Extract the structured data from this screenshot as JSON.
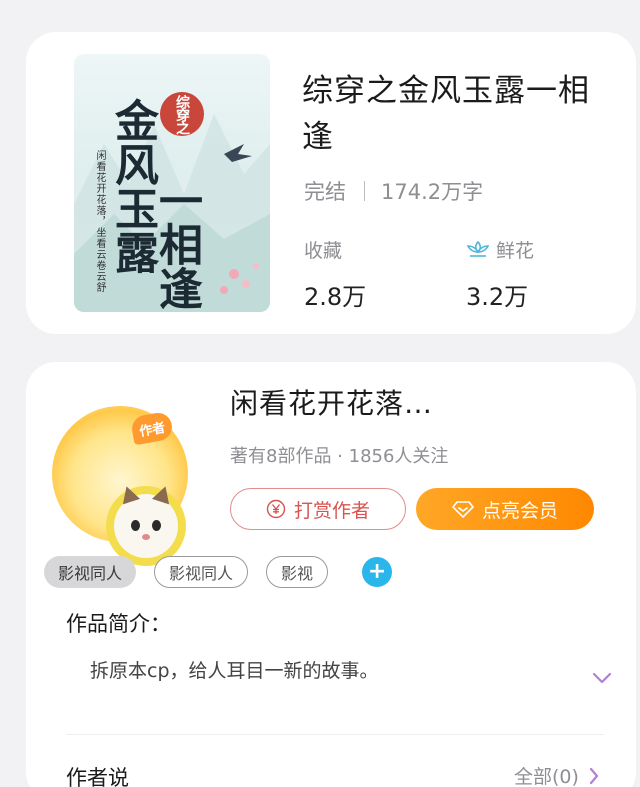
{
  "book": {
    "title": "综穿之金风玉露一相逢",
    "status": "完结",
    "word_count": "174.2万字",
    "favorites_label": "收藏",
    "favorites_value": "2.8万",
    "flowers_label": "鲜花",
    "flowers_value": "3.2万",
    "cover": {
      "stamp": "综穿之",
      "title_line1": "金风玉露",
      "title_line2": "一相逢",
      "author_line": "闲看花开花落，坐看云卷云舒"
    }
  },
  "author": {
    "avatar_badge": "作者",
    "name": "闲看花开花落…",
    "stats": "著有8部作品 · 1856人关注",
    "tip_button": "打赏作者",
    "vip_button": "点亮会员"
  },
  "tags": [
    "影视同人",
    "影视同人",
    "影视"
  ],
  "tag_add": "+",
  "intro": {
    "heading": "作品简介：",
    "text": "拆原本cp，给人耳目一新的故事。"
  },
  "author_says": {
    "heading": "作者说",
    "all_label": "全部(0)"
  },
  "colors": {
    "accent_orange": "#ff8800",
    "tip_red": "#d9534f",
    "add_blue": "#2ab6ea",
    "expand_purple": "#b27fd6"
  }
}
